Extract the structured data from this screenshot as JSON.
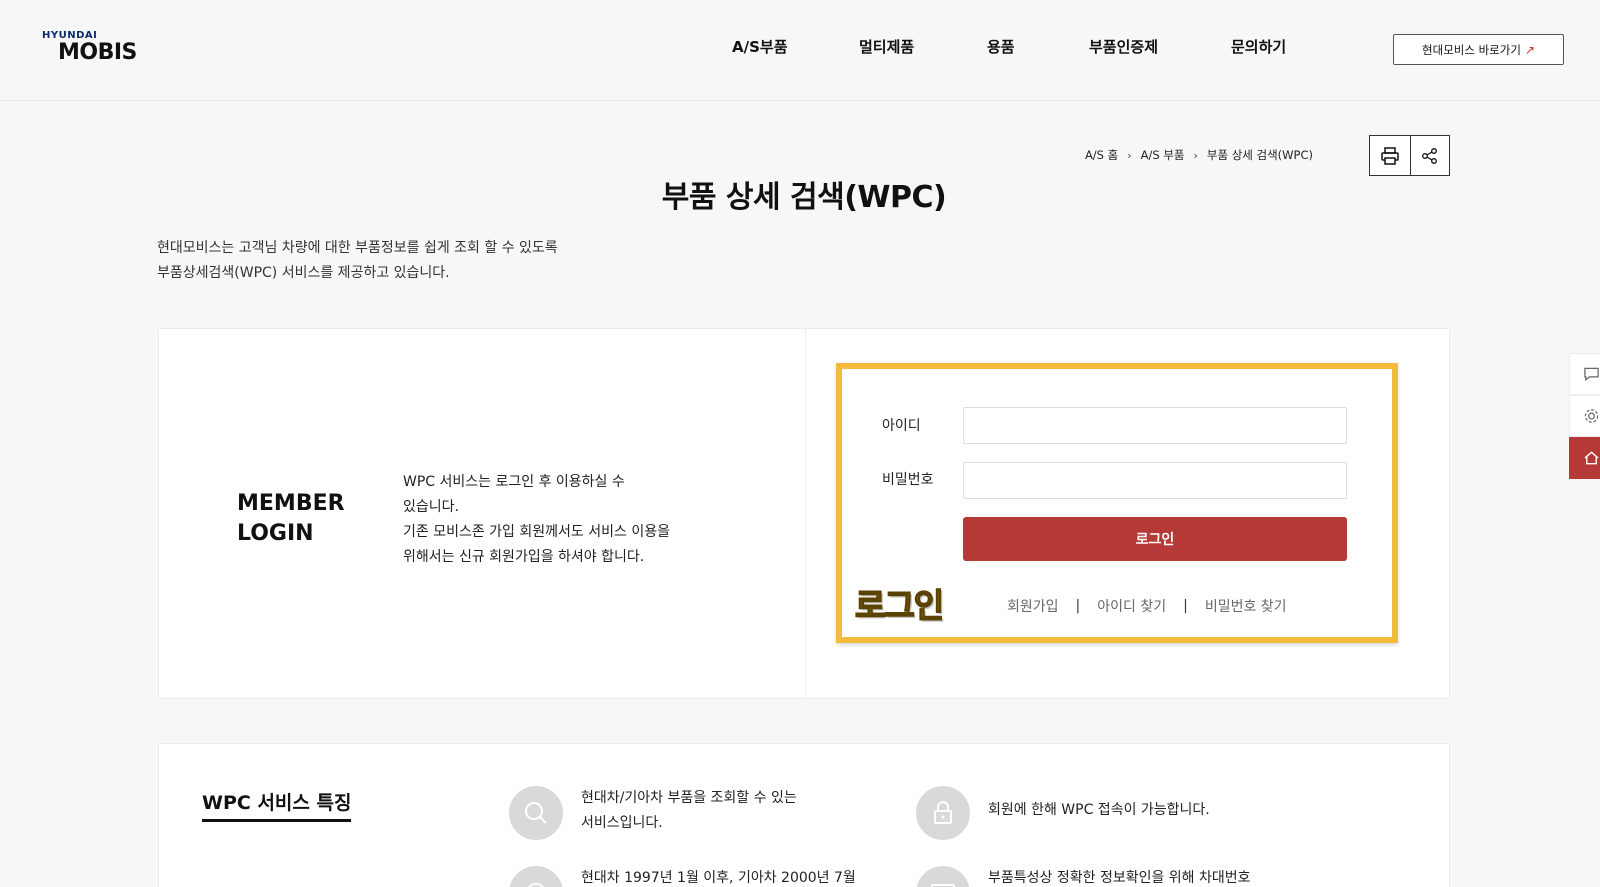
{
  "header": {
    "logo_top": "HYUNDAI",
    "logo_bottom": "MOBIS",
    "nav": [
      "A/S부품",
      "멀티제품",
      "용품",
      "부품인증제",
      "문의하기"
    ],
    "external_link": "현대모비스 바로가기"
  },
  "breadcrumb": [
    "A/S 홈",
    "A/S 부품",
    "부품 상세 검색(WPC)"
  ],
  "page": {
    "title": "부품 상세 검색(WPC)",
    "intro_line1": "현대모비스는 고객님 차량에 대한 부품정보를 쉽게 조회 할 수 있도록",
    "intro_line2": "부품상세검색(WPC) 서비스를 제공하고 있습니다."
  },
  "login": {
    "heading_line1": "MEMBER",
    "heading_line2": "LOGIN",
    "desc_line1": "WPC 서비스는 로그인 후 이용하실 수",
    "desc_line2": "있습니다.",
    "desc_line3": "기존 모비스존 가입 회원께서도 서비스 이용을",
    "desc_line4": "위해서는 신규 회원가입을 하셔야 합니다.",
    "id_label": "아이디",
    "id_value": "",
    "pw_label": "비밀번호",
    "pw_value": "",
    "button": "로그인",
    "stamp": "로그인",
    "signup": "회원가입",
    "find_id": "아이디 찾기",
    "find_pw": "비밀번호 찾기",
    "separator": "|"
  },
  "features": {
    "title": "WPC 서비스 특징",
    "items": [
      {
        "icon": "search-icon",
        "line1": "현대차/기아차 부품을 조회할 수 있는",
        "line2": "서비스입니다."
      },
      {
        "icon": "lock-icon",
        "line1": "회원에 한해 WPC 접속이 가능합니다.",
        "line2": ""
      },
      {
        "icon": "clock-icon",
        "line1": "현대차 1997년 1월 이후, 기아차 2000년 7월",
        "line2": ""
      },
      {
        "icon": "card-icon",
        "line1": "부품특성상 정확한 정보확인을 위해 차대번호",
        "line2": ""
      }
    ]
  },
  "colors": {
    "accent": "#b53a37",
    "highlight": "#f2bb3c"
  }
}
